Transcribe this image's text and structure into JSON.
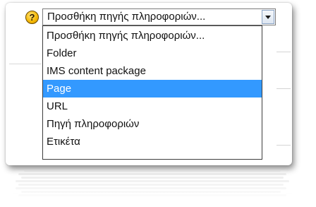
{
  "help_icon_glyph": "?",
  "select": {
    "value": "Προσθήκη πηγής πληροφοριών..."
  },
  "dropdown": {
    "options": [
      "Προσθήκη πηγής πληροφοριών...",
      "Folder",
      "IMS content package",
      "Page",
      "URL",
      "Πηγή πληροφοριών",
      "Ετικέτα"
    ],
    "selected_index": 3
  },
  "colors": {
    "highlight": "#3399ff",
    "help_icon": "#f3b600"
  },
  "icons": {
    "help": "question-circle-icon",
    "arrow": "chevron-down-icon"
  }
}
